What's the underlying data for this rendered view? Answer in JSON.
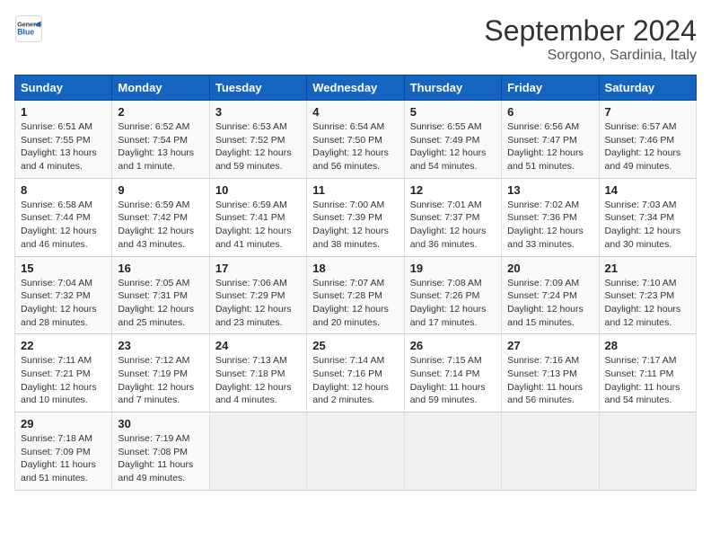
{
  "header": {
    "logo_general": "General",
    "logo_blue": "Blue",
    "month_title": "September 2024",
    "location": "Sorgono, Sardinia, Italy"
  },
  "calendar": {
    "weekdays": [
      "Sunday",
      "Monday",
      "Tuesday",
      "Wednesday",
      "Thursday",
      "Friday",
      "Saturday"
    ],
    "weeks": [
      [
        null,
        null,
        null,
        null,
        null,
        null,
        null
      ]
    ],
    "days": [
      {
        "date": 1,
        "dow": 0,
        "sunrise": "6:51 AM",
        "sunset": "7:55 PM",
        "daylight": "13 hours and 4 minutes."
      },
      {
        "date": 2,
        "dow": 1,
        "sunrise": "6:52 AM",
        "sunset": "7:54 PM",
        "daylight": "13 hours and 1 minute."
      },
      {
        "date": 3,
        "dow": 2,
        "sunrise": "6:53 AM",
        "sunset": "7:52 PM",
        "daylight": "12 hours and 59 minutes."
      },
      {
        "date": 4,
        "dow": 3,
        "sunrise": "6:54 AM",
        "sunset": "7:50 PM",
        "daylight": "12 hours and 56 minutes."
      },
      {
        "date": 5,
        "dow": 4,
        "sunrise": "6:55 AM",
        "sunset": "7:49 PM",
        "daylight": "12 hours and 54 minutes."
      },
      {
        "date": 6,
        "dow": 5,
        "sunrise": "6:56 AM",
        "sunset": "7:47 PM",
        "daylight": "12 hours and 51 minutes."
      },
      {
        "date": 7,
        "dow": 6,
        "sunrise": "6:57 AM",
        "sunset": "7:46 PM",
        "daylight": "12 hours and 49 minutes."
      },
      {
        "date": 8,
        "dow": 0,
        "sunrise": "6:58 AM",
        "sunset": "7:44 PM",
        "daylight": "12 hours and 46 minutes."
      },
      {
        "date": 9,
        "dow": 1,
        "sunrise": "6:59 AM",
        "sunset": "7:42 PM",
        "daylight": "12 hours and 43 minutes."
      },
      {
        "date": 10,
        "dow": 2,
        "sunrise": "6:59 AM",
        "sunset": "7:41 PM",
        "daylight": "12 hours and 41 minutes."
      },
      {
        "date": 11,
        "dow": 3,
        "sunrise": "7:00 AM",
        "sunset": "7:39 PM",
        "daylight": "12 hours and 38 minutes."
      },
      {
        "date": 12,
        "dow": 4,
        "sunrise": "7:01 AM",
        "sunset": "7:37 PM",
        "daylight": "12 hours and 36 minutes."
      },
      {
        "date": 13,
        "dow": 5,
        "sunrise": "7:02 AM",
        "sunset": "7:36 PM",
        "daylight": "12 hours and 33 minutes."
      },
      {
        "date": 14,
        "dow": 6,
        "sunrise": "7:03 AM",
        "sunset": "7:34 PM",
        "daylight": "12 hours and 30 minutes."
      },
      {
        "date": 15,
        "dow": 0,
        "sunrise": "7:04 AM",
        "sunset": "7:32 PM",
        "daylight": "12 hours and 28 minutes."
      },
      {
        "date": 16,
        "dow": 1,
        "sunrise": "7:05 AM",
        "sunset": "7:31 PM",
        "daylight": "12 hours and 25 minutes."
      },
      {
        "date": 17,
        "dow": 2,
        "sunrise": "7:06 AM",
        "sunset": "7:29 PM",
        "daylight": "12 hours and 23 minutes."
      },
      {
        "date": 18,
        "dow": 3,
        "sunrise": "7:07 AM",
        "sunset": "7:28 PM",
        "daylight": "12 hours and 20 minutes."
      },
      {
        "date": 19,
        "dow": 4,
        "sunrise": "7:08 AM",
        "sunset": "7:26 PM",
        "daylight": "12 hours and 17 minutes."
      },
      {
        "date": 20,
        "dow": 5,
        "sunrise": "7:09 AM",
        "sunset": "7:24 PM",
        "daylight": "12 hours and 15 minutes."
      },
      {
        "date": 21,
        "dow": 6,
        "sunrise": "7:10 AM",
        "sunset": "7:23 PM",
        "daylight": "12 hours and 12 minutes."
      },
      {
        "date": 22,
        "dow": 0,
        "sunrise": "7:11 AM",
        "sunset": "7:21 PM",
        "daylight": "12 hours and 10 minutes."
      },
      {
        "date": 23,
        "dow": 1,
        "sunrise": "7:12 AM",
        "sunset": "7:19 PM",
        "daylight": "12 hours and 7 minutes."
      },
      {
        "date": 24,
        "dow": 2,
        "sunrise": "7:13 AM",
        "sunset": "7:18 PM",
        "daylight": "12 hours and 4 minutes."
      },
      {
        "date": 25,
        "dow": 3,
        "sunrise": "7:14 AM",
        "sunset": "7:16 PM",
        "daylight": "12 hours and 2 minutes."
      },
      {
        "date": 26,
        "dow": 4,
        "sunrise": "7:15 AM",
        "sunset": "7:14 PM",
        "daylight": "11 hours and 59 minutes."
      },
      {
        "date": 27,
        "dow": 5,
        "sunrise": "7:16 AM",
        "sunset": "7:13 PM",
        "daylight": "11 hours and 56 minutes."
      },
      {
        "date": 28,
        "dow": 6,
        "sunrise": "7:17 AM",
        "sunset": "7:11 PM",
        "daylight": "11 hours and 54 minutes."
      },
      {
        "date": 29,
        "dow": 0,
        "sunrise": "7:18 AM",
        "sunset": "7:09 PM",
        "daylight": "11 hours and 51 minutes."
      },
      {
        "date": 30,
        "dow": 1,
        "sunrise": "7:19 AM",
        "sunset": "7:08 PM",
        "daylight": "11 hours and 49 minutes."
      }
    ]
  }
}
